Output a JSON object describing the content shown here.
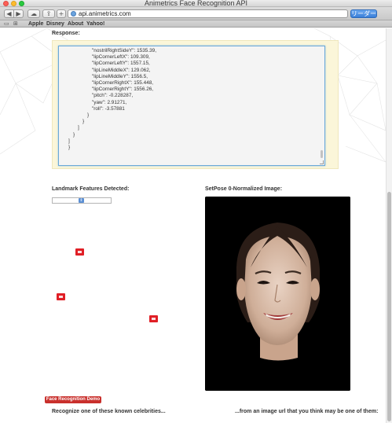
{
  "window": {
    "title": "Animetrics Face Recognition API"
  },
  "toolbar": {
    "back_icon": "back-arrow-icon",
    "forward_icon": "forward-arrow-icon",
    "back_glyph": "◀",
    "forward_glyph": "▶",
    "cloud_glyph": "☁",
    "share_glyph": "⇪",
    "add_glyph": "+",
    "url": "api.animetrics.com",
    "reader_label": "リーダー"
  },
  "bookmarks": {
    "icons": [
      "book-icon",
      "grid-icon"
    ],
    "items": [
      "Apple",
      "Disney",
      "About",
      "Yahoo!"
    ]
  },
  "response": {
    "label": "Response:",
    "lines": [
      "\"nostrilRightSideY\": 1535.39,",
      "\"lipCornerLeftX\": 109.309,",
      "\"lipCornerLeftY\": 1557.15,",
      "\"lipLineMiddleX\": 129.062,",
      "\"lipLineMiddleY\": 1556.5,",
      "\"lipCornerRightX\": 155.448,",
      "\"lipCornerRightY\": 1556.26,",
      "\"pitch\": -0.228287,",
      "\"yaw\": 2.91271,",
      "\"roll\": -3.57881",
      "}",
      "}",
      "]",
      "}",
      "]",
      "}"
    ]
  },
  "landmarks": {
    "label": "Landmark Features Detected:",
    "select_glyph": "⇕"
  },
  "setpose": {
    "label": "SetPose 0-Normalized Image:"
  },
  "demo": {
    "badge": "Face Recognition Demo"
  },
  "footer": {
    "left": "Recognize one of these known celebrities...",
    "right": "...from an image url that you think may be one of them:"
  },
  "colors": {
    "accent": "#c9302c",
    "marker": "#e01f26",
    "response_bg": "#fbf6d9",
    "reader": "#3a7fd8"
  }
}
